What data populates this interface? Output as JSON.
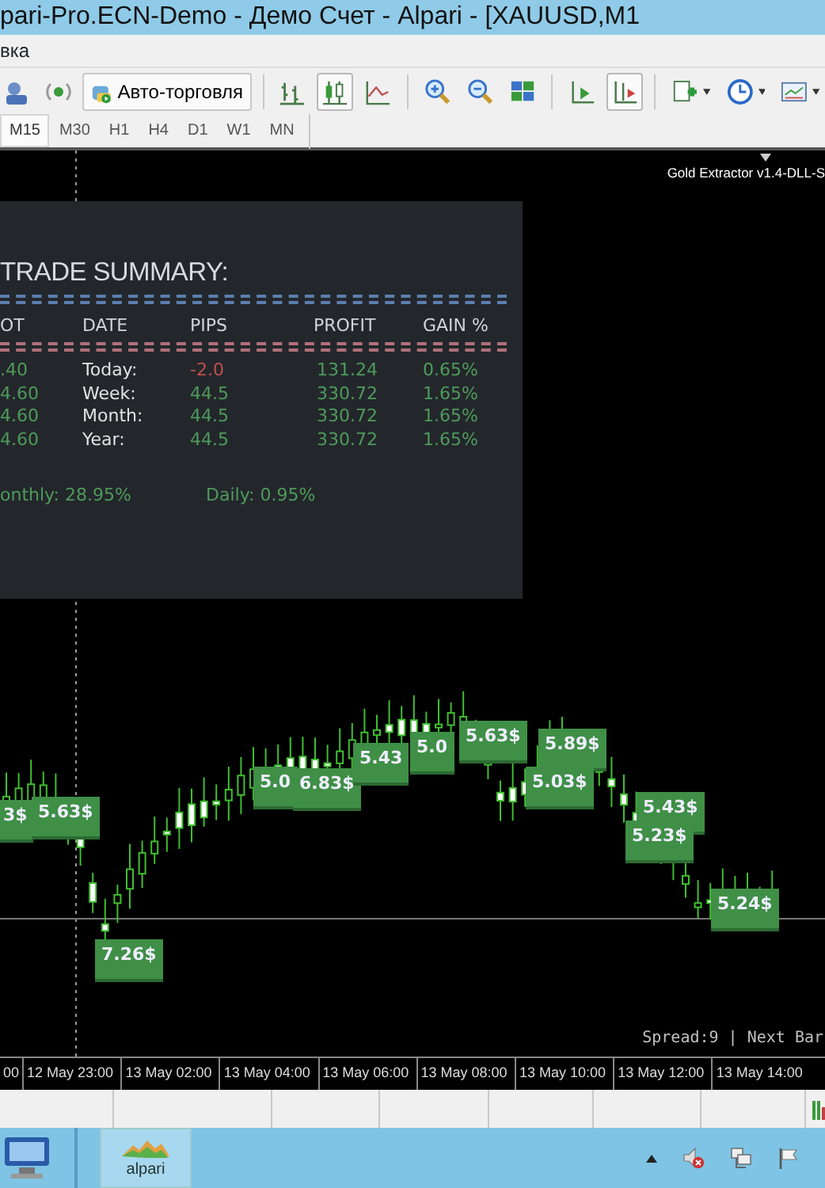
{
  "window": {
    "title": "pari-Pro.ECN-Demo - Демо Счет - Alpari - [XAUUSD,M1"
  },
  "menu": [
    "вка"
  ],
  "toolbar": [
    {
      "kind": "accounts",
      "pressed": false
    },
    {
      "kind": "signal",
      "pressed": false
    },
    {
      "kind": "autotrade",
      "label": "Авто-торговля",
      "pressed": false
    },
    {
      "kind": "sep"
    },
    {
      "kind": "bars",
      "pressed": false
    },
    {
      "kind": "candles",
      "pressed": true
    },
    {
      "kind": "line",
      "pressed": false
    },
    {
      "kind": "sep"
    },
    {
      "kind": "zoom-in",
      "pressed": false
    },
    {
      "kind": "zoom-out",
      "pressed": false
    },
    {
      "kind": "tile",
      "pressed": false
    },
    {
      "kind": "sep"
    },
    {
      "kind": "autoscroll",
      "pressed": false
    },
    {
      "kind": "shift",
      "pressed": true
    },
    {
      "kind": "sep"
    },
    {
      "kind": "new-chart",
      "pressed": false
    },
    {
      "kind": "clock",
      "pressed": false
    },
    {
      "kind": "template",
      "pressed": false
    }
  ],
  "timeframes": [
    {
      "label": "M15",
      "selected": true
    },
    {
      "label": "M30",
      "selected": false
    },
    {
      "label": "H1",
      "selected": false
    },
    {
      "label": "H4",
      "selected": false
    },
    {
      "label": "D1",
      "selected": false
    },
    {
      "label": "W1",
      "selected": false
    },
    {
      "label": "MN",
      "selected": false
    }
  ],
  "chart": {
    "indicator": "Gold Extractor v1.4-DLL-S",
    "summary": {
      "title": "TRADE SUMMARY:",
      "columns": [
        "OT",
        "DATE",
        "PIPS",
        "PROFIT",
        "GAIN %"
      ],
      "rows": [
        {
          "lot": ".40",
          "date": "Today:",
          "pips": "-2.0",
          "pips_negative": true,
          "profit": "131.24",
          "gain": "0.65%"
        },
        {
          "lot": "4.60",
          "date": "Week:",
          "pips": "44.5",
          "pips_negative": false,
          "profit": "330.72",
          "gain": "1.65%"
        },
        {
          "lot": "4.60",
          "date": "Month:",
          "pips": "44.5",
          "pips_negative": false,
          "profit": "330.72",
          "gain": "1.65%"
        },
        {
          "lot": "4.60",
          "date": "Year:",
          "pips": "44.5",
          "pips_negative": false,
          "profit": "330.72",
          "gain": "1.65%"
        }
      ],
      "monthly": "onthly: 28.95%",
      "daily": "Daily: 0.95%"
    },
    "labels": [
      "3$",
      "5.63$",
      "7.26$",
      "5.0",
      "6.83$",
      "5.43",
      "5.0",
      "5.63$",
      "5.89$",
      "5.03$",
      "5.43$",
      "5.23$",
      "5.24$"
    ],
    "status": "Spread:9 | Next Bar",
    "time_axis": [
      "00",
      "12 May 23:00",
      "13 May 02:00",
      "13 May 04:00",
      "13 May 06:00",
      "13 May 08:00",
      "13 May 10:00",
      "13 May 12:00",
      "13 May 14:00"
    ]
  },
  "taskbar": {
    "app": "alpari"
  }
}
